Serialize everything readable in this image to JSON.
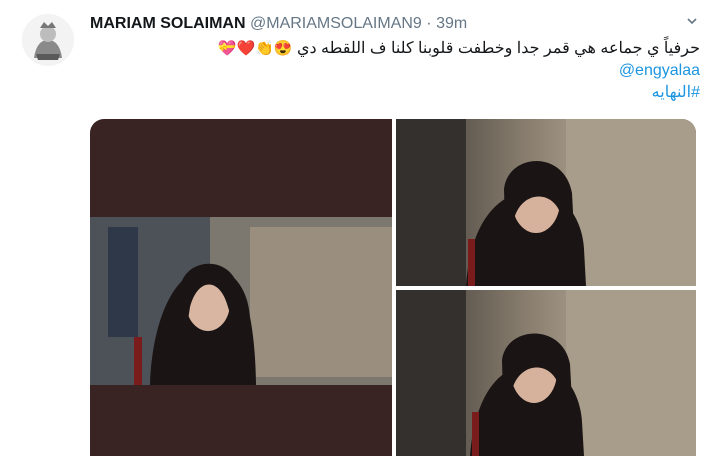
{
  "tweet": {
    "author_name": "MARIAM SOLAIMAN",
    "author_handle": "@MARIAMSOLAIMAN9",
    "separator": "·",
    "timestamp": "39m",
    "text_line1": "حرفياً ي جماعه هي قمر جدا وخطفت قلوبنا كلنا ف اللقطه دي",
    "text_emojis": "😍👏❤️💝",
    "mention": "@engyalaa",
    "hashtag": "#النهايه"
  },
  "icons": {
    "caret": "chevron-down-icon",
    "avatar": "avatar-image"
  },
  "media": {
    "photo_count": 3,
    "frame_color": "#3a2323"
  },
  "colors": {
    "link": "#1b95e0",
    "secondary_text": "#657786",
    "primary_text": "#14171a"
  }
}
